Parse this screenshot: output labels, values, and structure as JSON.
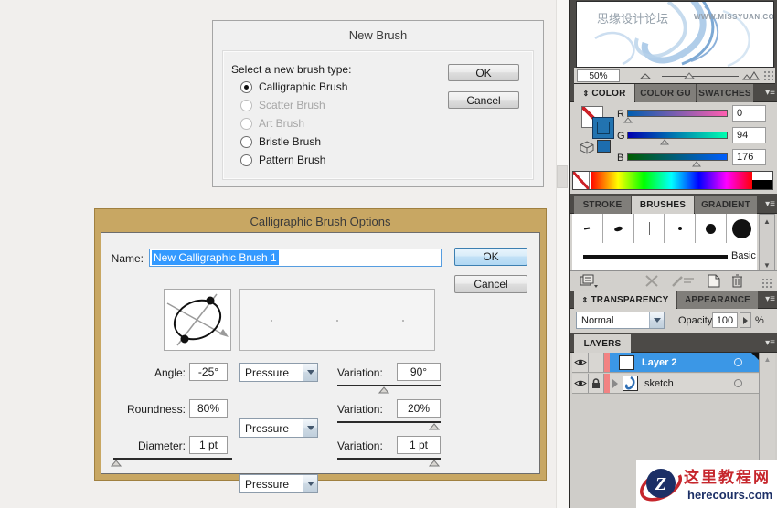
{
  "new_brush": {
    "title": "New Brush",
    "prompt": "Select a new brush type:",
    "options": [
      {
        "label": "Calligraphic Brush",
        "state": "selected"
      },
      {
        "label": "Scatter Brush",
        "state": "disabled"
      },
      {
        "label": "Art Brush",
        "state": "disabled"
      },
      {
        "label": "Bristle Brush",
        "state": "normal"
      },
      {
        "label": "Pattern Brush",
        "state": "normal"
      }
    ],
    "ok": "OK",
    "cancel": "Cancel"
  },
  "brush_options": {
    "title": "Calligraphic Brush Options",
    "name_label": "Name:",
    "name_value": "New Calligraphic Brush 1",
    "ok": "OK",
    "cancel": "Cancel",
    "rows": [
      {
        "label": "Angle:",
        "value": "-25°",
        "dynamics": "Pressure",
        "variation_label": "Variation:",
        "variation_value": "90°"
      },
      {
        "label": "Roundness:",
        "value": "80%",
        "dynamics": "Pressure",
        "variation_label": "Variation:",
        "variation_value": "20%"
      },
      {
        "label": "Diameter:",
        "value": "1 pt",
        "dynamics": "Pressure",
        "variation_label": "Variation:",
        "variation_value": "1 pt"
      }
    ]
  },
  "navigator": {
    "watermark_cn": "思缘设计论坛",
    "watermark_url": "WWW.MISSYUAN.COM",
    "zoom": "50%"
  },
  "color": {
    "tab_color": "COLOR",
    "tab_guide": "COLOR GU",
    "tab_swatches": "SWATCHES",
    "r_label": "R",
    "r_value": "0",
    "g_label": "G",
    "g_value": "94",
    "b_label": "B",
    "b_value": "176",
    "current_rgb": "#005eb0"
  },
  "brushes": {
    "tab_stroke": "STROKE",
    "tab_brushes": "BRUSHES",
    "tab_gradient": "GRADIENT",
    "basic": "Basic"
  },
  "transparency": {
    "tab_transparency": "TRANSPARENCY",
    "tab_appearance": "APPEARANCE",
    "mode": "Normal",
    "opacity_label": "Opacity:",
    "opacity_value": "100",
    "percent": "%"
  },
  "layers": {
    "tab": "LAYERS",
    "rows": [
      {
        "name": "Layer 2"
      },
      {
        "name": "sketch"
      }
    ]
  },
  "logo": {
    "cn": "这里教程网",
    "site": "herecours.com"
  }
}
